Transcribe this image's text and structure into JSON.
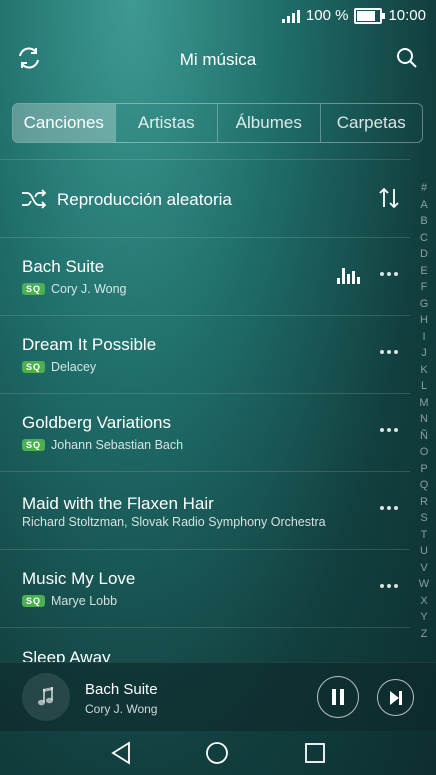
{
  "status": {
    "battery": "100 %",
    "time": "10:00",
    "battery_level": 1.0
  },
  "header": {
    "title": "Mi música",
    "refresh_icon": "refresh-icon",
    "search_icon": "search-icon"
  },
  "tabs": [
    {
      "label": "Canciones",
      "active": true
    },
    {
      "label": "Artistas",
      "active": false
    },
    {
      "label": "Álbumes",
      "active": false
    },
    {
      "label": "Carpetas",
      "active": false
    }
  ],
  "shuffle": {
    "label": "Reproducción aleatoria",
    "icon": "shuffle-icon",
    "sort_icon": "sort-icon"
  },
  "songs": [
    {
      "title": "Bach Suite",
      "artist": "Cory J. Wong",
      "sq": "SQ",
      "playing": true
    },
    {
      "title": "Dream It Possible",
      "artist": "Delacey",
      "sq": "SQ",
      "playing": false
    },
    {
      "title": "Goldberg Variations",
      "artist": "Johann Sebastian Bach",
      "sq": "SQ",
      "playing": false
    },
    {
      "title": "Maid with the Flaxen Hair",
      "artist": "Richard Stoltzman, Slovak Radio Symphony Orchestra",
      "sq": "",
      "playing": false
    },
    {
      "title": "Music My Love",
      "artist": "Marye Lobb",
      "sq": "SQ",
      "playing": false
    },
    {
      "title": "Sleep Away",
      "artist": "",
      "sq": "",
      "playing": false
    }
  ],
  "alphabet": [
    "#",
    "A",
    "B",
    "C",
    "D",
    "E",
    "F",
    "G",
    "H",
    "I",
    "J",
    "K",
    "L",
    "M",
    "N",
    "Ñ",
    "O",
    "P",
    "Q",
    "R",
    "S",
    "T",
    "U",
    "V",
    "W",
    "X",
    "Y",
    "Z"
  ],
  "now_playing": {
    "title": "Bach Suite",
    "artist": "Cory J. Wong",
    "icon": "music-note-icon"
  },
  "accent": "#4caf50"
}
